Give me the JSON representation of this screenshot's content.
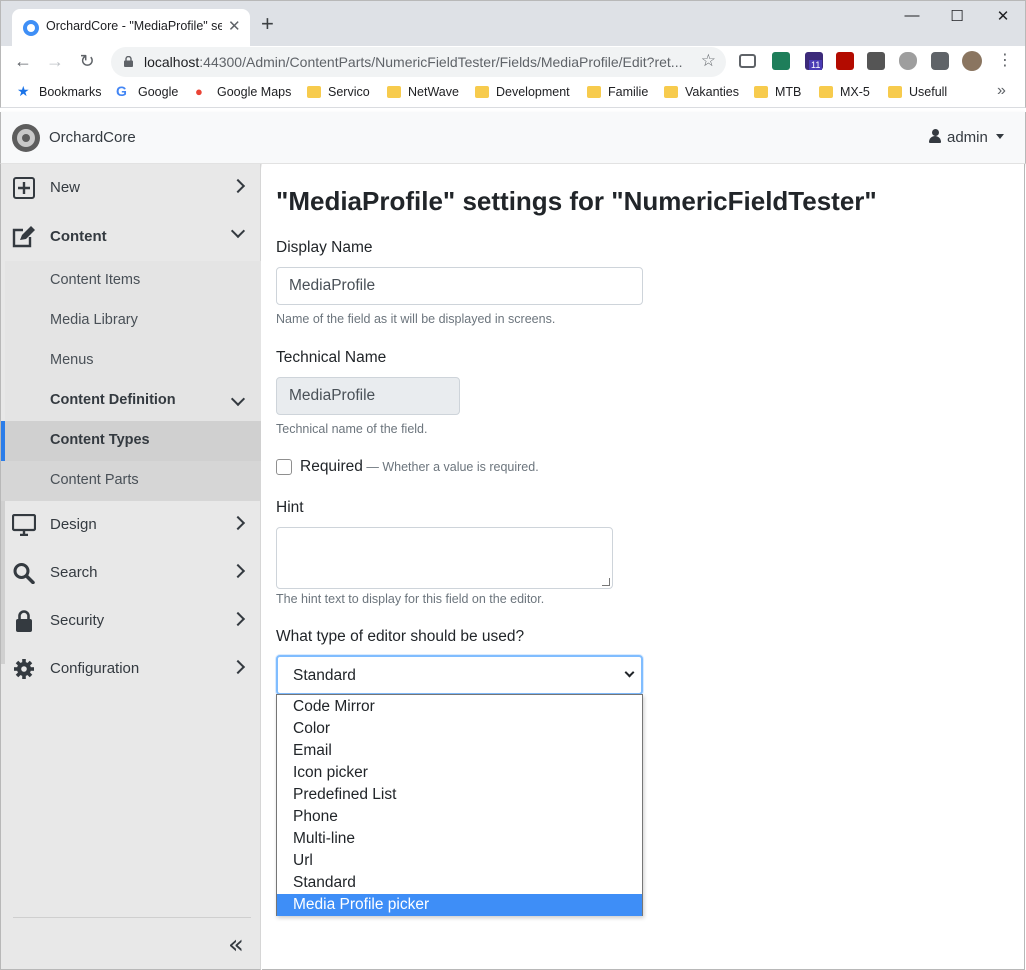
{
  "browser": {
    "tab_title": "OrchardCore - \"MediaProfile\" set",
    "tab_close": "✕",
    "new_tab": "+",
    "url_host": "localhost",
    "url_rest": ":44300/Admin/ContentParts/NumericFieldTester/Fields/MediaProfile/Edit?ret...",
    "extension_badge": "11",
    "window_controls": {
      "minimize": "—",
      "maximize": "☐",
      "close": "✕"
    },
    "nav": {
      "back": "←",
      "forward": "→",
      "reload": "↻"
    }
  },
  "bookmarks": [
    {
      "label": "Bookmarks",
      "icon": "star-icon"
    },
    {
      "label": "Google",
      "icon": "google-icon"
    },
    {
      "label": "Google Maps",
      "icon": "maps-icon"
    },
    {
      "label": "Servico",
      "icon": "folder-icon"
    },
    {
      "label": "NetWave",
      "icon": "folder-icon"
    },
    {
      "label": "Development",
      "icon": "folder-icon"
    },
    {
      "label": "Familie",
      "icon": "folder-icon"
    },
    {
      "label": "Vakanties",
      "icon": "folder-icon"
    },
    {
      "label": "MTB",
      "icon": "folder-icon"
    },
    {
      "label": "MX-5",
      "icon": "folder-icon"
    },
    {
      "label": "Usefull",
      "icon": "folder-icon"
    }
  ],
  "bookmarks_more": "»",
  "header": {
    "brand": "OrchardCore",
    "user": "admin"
  },
  "sidebar": {
    "items": [
      {
        "label": "New",
        "icon": "plus-square-icon"
      },
      {
        "label": "Content",
        "icon": "edit-icon"
      },
      {
        "label": "Design",
        "icon": "monitor-icon"
      },
      {
        "label": "Search",
        "icon": "search-icon"
      },
      {
        "label": "Security",
        "icon": "lock-icon"
      },
      {
        "label": "Configuration",
        "icon": "gear-icon"
      }
    ],
    "content_sub": [
      {
        "label": "Content Items"
      },
      {
        "label": "Media Library"
      },
      {
        "label": "Menus"
      },
      {
        "label": "Content Definition"
      },
      {
        "label": "Content Types"
      },
      {
        "label": "Content Parts"
      }
    ],
    "collapse": "«"
  },
  "form": {
    "title": "\"MediaProfile\" settings for \"NumericFieldTester\"",
    "display_name_label": "Display Name",
    "display_name_value": "MediaProfile",
    "display_name_help": "Name of the field as it will be displayed in screens.",
    "technical_name_label": "Technical Name",
    "technical_name_value": "MediaProfile",
    "technical_name_help": "Technical name of the field.",
    "required_label": "Required",
    "required_hint": " — Whether a value is required.",
    "hint_label": "Hint",
    "hint_value": "",
    "hint_help": "The hint text to display for this field on the editor.",
    "editor_label": "What type of editor should be used?",
    "editor_value": "Standard",
    "editor_options": [
      "Code Mirror",
      "Color",
      "Email",
      "Icon picker",
      "Predefined List",
      "Phone",
      "Multi-line",
      "Url",
      "Standard",
      "Media Profile picker"
    ],
    "highlighted_option": "Media Profile picker"
  },
  "colors": {
    "accent": "#2b7de9",
    "option_highlight": "#3e8ef7",
    "sidebar_bg": "#e8e8e8",
    "focus_border": "#80bdff"
  }
}
